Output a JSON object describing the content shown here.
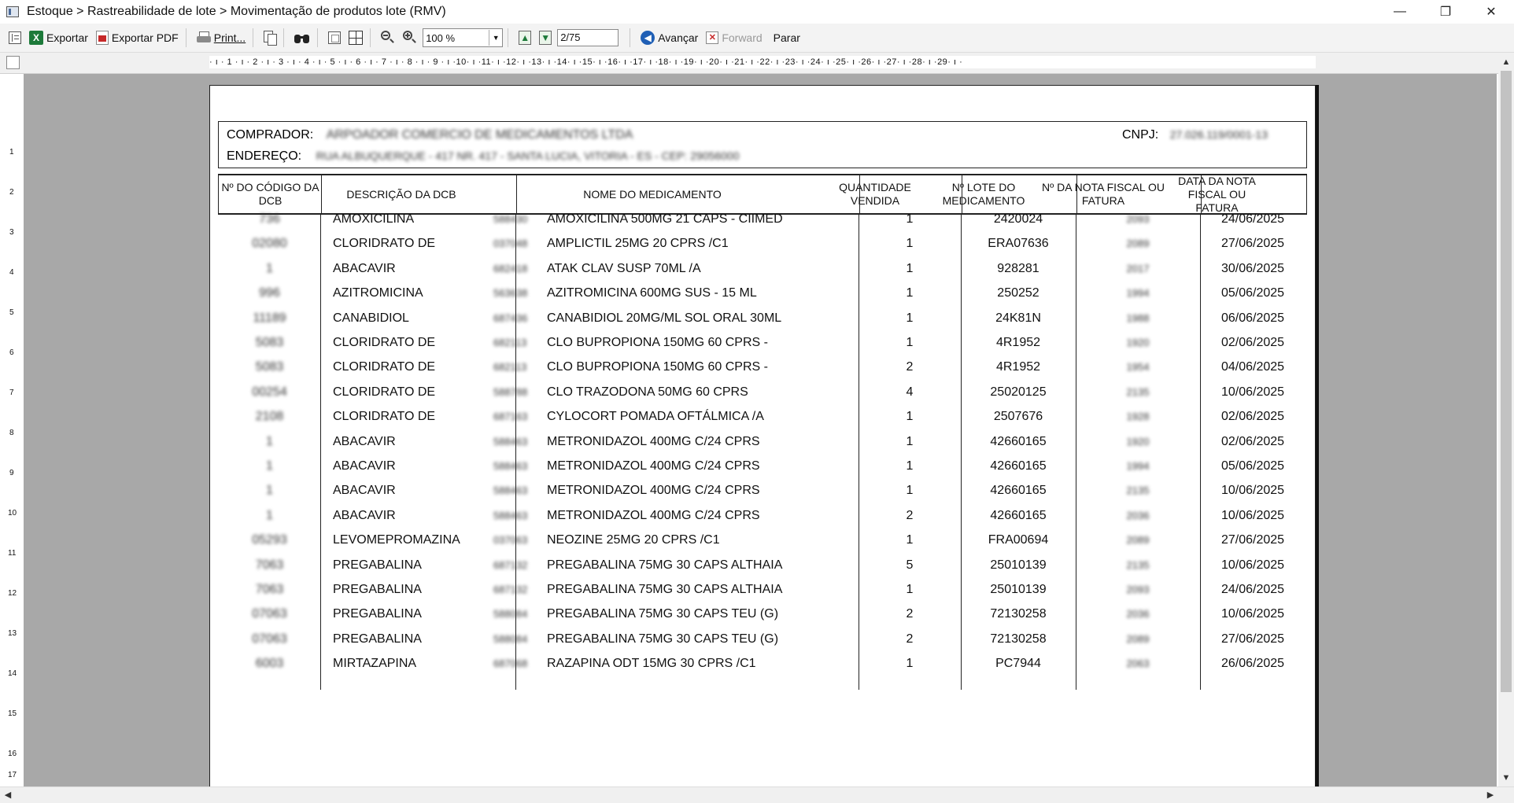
{
  "window": {
    "title": "Estoque > Rastreabilidade de lote > Movimentação de produtos lote (RMV)",
    "minimize": "—",
    "restore": "❐",
    "close": "✕"
  },
  "toolbar": {
    "export_label": "Exportar",
    "export_pdf_label": "Exportar PDF",
    "print_label": "Print...",
    "zoom_value": "100 %",
    "page_value": "2/75",
    "advance_label": "Avançar",
    "forward_label": "Forward",
    "stop_label": "Parar"
  },
  "ruler": {
    "h_marks": "· ı · 1 · ı · 2 · ı · 3 · ı · 4 · ı · 5 · ı · 6 · ı · 7 · ı · 8 · ı · 9 · ı ·10· ı ·11· ı ·12· ı ·13· ı ·14· ı ·15· ı ·16· ı ·17· ı ·18· ı ·19· ı ·20· ı ·21· ı ·22· ı ·23· ı ·24· ı ·25· ı ·26· ı ·27· ı ·28· ı ·29· ı ·",
    "v_numbers": [
      "1",
      "2",
      "3",
      "4",
      "5",
      "6",
      "7",
      "8",
      "9",
      "10",
      "11",
      "12",
      "13",
      "14",
      "15",
      "16",
      "17"
    ]
  },
  "report": {
    "buyer_label": "COMPRADOR:",
    "buyer_value": "ARPOADOR COMERCIO DE MEDICAMENTOS LTDA",
    "address_label": "ENDEREÇO:",
    "address_value": "RUA ALBUQUERQUE - 417 NR. 417 - SANTA LUCIA, VITORIA - ES - CEP: 29056000",
    "cnpj_label": "CNPJ:",
    "cnpj_value": "27.026.119/0001-13",
    "columns": [
      "Nº DO CÓDIGO DA DCB",
      "DESCRIÇÃO DA DCB",
      "NOME DO MEDICAMENTO",
      "QUANTIDADE VENDIDA",
      "Nº LOTE DO MEDICAMENTO",
      "Nº DA NOTA FISCAL OU FATURA",
      "DATA DA NOTA FISCAL OU FATURA"
    ],
    "rows": [
      {
        "code": "736",
        "dcb": "AMOXICILINA",
        "sku": "588430",
        "medicine": "AMOXICILINA 500MG 21 CAPS - CIIMED",
        "qty": "1",
        "lot": "2420024",
        "invoice": "2093",
        "date": "24/06/2025"
      },
      {
        "code": "02080",
        "dcb": "CLORIDRATO DE",
        "sku": "037048",
        "medicine": "AMPLICTIL 25MG 20 CPRS /C1",
        "qty": "1",
        "lot": "ERA07636",
        "invoice": "2089",
        "date": "27/06/2025"
      },
      {
        "code": "1",
        "dcb": "ABACAVIR",
        "sku": "682418",
        "medicine": "ATAK CLAV SUSP 70ML /A",
        "qty": "1",
        "lot": "928281",
        "invoice": "2017",
        "date": "30/06/2025"
      },
      {
        "code": "996",
        "dcb": "AZITROMICINA",
        "sku": "563638",
        "medicine": "AZITROMICINA 600MG SUS - 15 ML",
        "qty": "1",
        "lot": "250252",
        "invoice": "1994",
        "date": "05/06/2025"
      },
      {
        "code": "11189",
        "dcb": "CANABIDIOL",
        "sku": "687436",
        "medicine": "CANABIDIOL 20MG/ML SOL ORAL 30ML",
        "qty": "1",
        "lot": "24K81N",
        "invoice": "1988",
        "date": "06/06/2025"
      },
      {
        "code": "5083",
        "dcb": "CLORIDRATO DE",
        "sku": "682113",
        "medicine": "CLO BUPROPIONA 150MG 60 CPRS -",
        "qty": "1",
        "lot": "4R1952",
        "invoice": "1920",
        "date": "02/06/2025"
      },
      {
        "code": "5083",
        "dcb": "CLORIDRATO DE",
        "sku": "682113",
        "medicine": "CLO BUPROPIONA 150MG 60 CPRS -",
        "qty": "2",
        "lot": "4R1952",
        "invoice": "1954",
        "date": "04/06/2025"
      },
      {
        "code": "00254",
        "dcb": "CLORIDRATO DE",
        "sku": "588788",
        "medicine": "CLO TRAZODONA 50MG 60 CPRS",
        "qty": "4",
        "lot": "25020125",
        "invoice": "2135",
        "date": "10/06/2025"
      },
      {
        "code": "2108",
        "dcb": "CLORIDRATO DE",
        "sku": "687163",
        "medicine": "CYLOCORT POMADA OFTÁLMICA   /A",
        "qty": "1",
        "lot": "2507676",
        "invoice": "1928",
        "date": "02/06/2025"
      },
      {
        "code": "1",
        "dcb": "ABACAVIR",
        "sku": "588463",
        "medicine": "METRONIDAZOL 400MG C/24 CPRS",
        "qty": "1",
        "lot": "42660165",
        "invoice": "1920",
        "date": "02/06/2025"
      },
      {
        "code": "1",
        "dcb": "ABACAVIR",
        "sku": "588463",
        "medicine": "METRONIDAZOL 400MG C/24 CPRS",
        "qty": "1",
        "lot": "42660165",
        "invoice": "1994",
        "date": "05/06/2025"
      },
      {
        "code": "1",
        "dcb": "ABACAVIR",
        "sku": "588463",
        "medicine": "METRONIDAZOL 400MG C/24 CPRS",
        "qty": "1",
        "lot": "42660165",
        "invoice": "2135",
        "date": "10/06/2025"
      },
      {
        "code": "1",
        "dcb": "ABACAVIR",
        "sku": "588463",
        "medicine": "METRONIDAZOL 400MG C/24 CPRS",
        "qty": "2",
        "lot": "42660165",
        "invoice": "2036",
        "date": "10/06/2025"
      },
      {
        "code": "05293",
        "dcb": "LEVOMEPROMAZINA",
        "sku": "037063",
        "medicine": "NEOZINE 25MG 20 CPRS /C1",
        "qty": "1",
        "lot": "FRA00694",
        "invoice": "2089",
        "date": "27/06/2025"
      },
      {
        "code": "7063",
        "dcb": "PREGABALINA",
        "sku": "687132",
        "medicine": "PREGABALINA 75MG 30 CAPS ALTHAIA",
        "qty": "5",
        "lot": "25010139",
        "invoice": "2135",
        "date": "10/06/2025"
      },
      {
        "code": "7063",
        "dcb": "PREGABALINA",
        "sku": "687132",
        "medicine": "PREGABALINA 75MG 30 CAPS ALTHAIA",
        "qty": "1",
        "lot": "25010139",
        "invoice": "2093",
        "date": "24/06/2025"
      },
      {
        "code": "07063",
        "dcb": "PREGABALINA",
        "sku": "588084",
        "medicine": "PREGABALINA 75MG 30 CAPS TEU (G)",
        "qty": "2",
        "lot": "72130258",
        "invoice": "2036",
        "date": "10/06/2025"
      },
      {
        "code": "07063",
        "dcb": "PREGABALINA",
        "sku": "588084",
        "medicine": "PREGABALINA 75MG 30 CAPS TEU (G)",
        "qty": "2",
        "lot": "72130258",
        "invoice": "2089",
        "date": "27/06/2025"
      },
      {
        "code": "6003",
        "dcb": "MIRTAZAPINA",
        "sku": "687068",
        "medicine": "RAZAPINA ODT 15MG 30 CPRS /C1",
        "qty": "1",
        "lot": "PC7944",
        "invoice": "2063",
        "date": "26/06/2025"
      }
    ]
  },
  "colors": {
    "paper_bg": "#ffffff",
    "viewport_bg": "#a8a8a8",
    "toolbar_bg": "#f3f3f3",
    "accent_blue": "#1f5fb5",
    "excel_green": "#1d7a3a"
  }
}
